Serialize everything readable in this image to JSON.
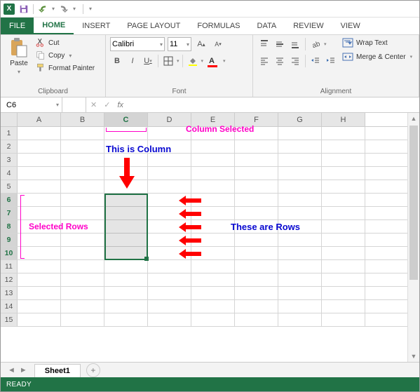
{
  "qat": {
    "app_icon_letter": "X"
  },
  "tabs": {
    "file": "FILE",
    "home": "HOME",
    "insert": "INSERT",
    "page_layout": "PAGE LAYOUT",
    "formulas": "FORMULAS",
    "data": "DATA",
    "review": "REVIEW",
    "view": "VIEW"
  },
  "ribbon": {
    "clipboard": {
      "paste": "Paste",
      "cut": "Cut",
      "copy": "Copy",
      "format_painter": "Format Painter",
      "group_label": "Clipboard"
    },
    "font": {
      "name": "Calibri",
      "size": "11",
      "bold": "B",
      "italic": "I",
      "underline": "U",
      "group_label": "Font"
    },
    "alignment": {
      "wrap": "Wrap Text",
      "merge": "Merge & Center",
      "group_label": "Alignment"
    }
  },
  "formula_bar": {
    "namebox": "C6",
    "fx_label": "fx"
  },
  "columns": [
    "A",
    "B",
    "C",
    "D",
    "E",
    "F",
    "G",
    "H"
  ],
  "selected_column_index": 2,
  "rows": [
    1,
    2,
    3,
    4,
    5,
    6,
    7,
    8,
    9,
    10,
    11,
    12,
    13,
    14,
    15
  ],
  "selected_rows": [
    6,
    7,
    8,
    9,
    10
  ],
  "selection": {
    "col": "C",
    "row_start": 6,
    "row_end": 10
  },
  "annotations": {
    "column_selected": "Column Selected",
    "this_is_column": "This is Column",
    "selected_rows": "Selected Rows",
    "these_are_rows": "These are Rows"
  },
  "sheet": {
    "name": "Sheet1"
  },
  "status": {
    "text": "READY"
  },
  "colors": {
    "accent": "#217346",
    "annotation_magenta": "#ff00c8",
    "annotation_blue": "#0707d1",
    "annotation_red": "#ff0000"
  }
}
